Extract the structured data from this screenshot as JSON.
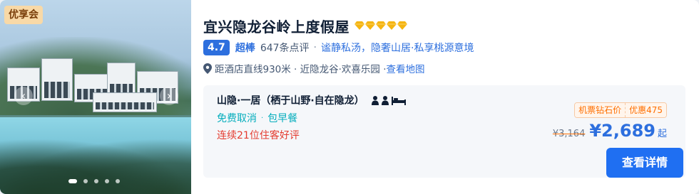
{
  "hotel": {
    "badge": "优享会",
    "name": "宜兴隐龙谷岭上度假屋",
    "diamond_count": 5,
    "score": "4.7",
    "score_label": "超棒",
    "review_count": "647条点评",
    "separator": "·",
    "tagline": "谧静私汤，隐奢山居·私享桃源意境",
    "location": "距酒店直线930米 · 近隐龙谷·欢喜乐园 · ",
    "map_link": "查看地图",
    "carousel": {
      "dots": 5,
      "active_index": 0
    }
  },
  "room": {
    "name": "山隐·一居（栖于山野·自在隐龙）",
    "cancel": "免费取消",
    "breakfast": "包早餐",
    "dot": "·",
    "promo": "连续21位住客好评",
    "tag_label": "机票钻石价",
    "tag_discount": "优惠475",
    "original_price": "¥3,164",
    "price": "¥2,689",
    "price_suffix": "起",
    "cta": "查看详情"
  },
  "colors": {
    "accent": "#2d6fde",
    "button": "#1f6ff2",
    "diamond": "#f5b512",
    "green": "#06aebd",
    "red": "#e43b2f",
    "orange": "#ff6f00"
  },
  "icons": {
    "left_arrow": "chevron-left-icon",
    "right_arrow": "chevron-right-icon",
    "location": "location-pin-icon",
    "guests": "person-icon",
    "bed": "bed-icon",
    "diamond": "diamond-icon"
  }
}
